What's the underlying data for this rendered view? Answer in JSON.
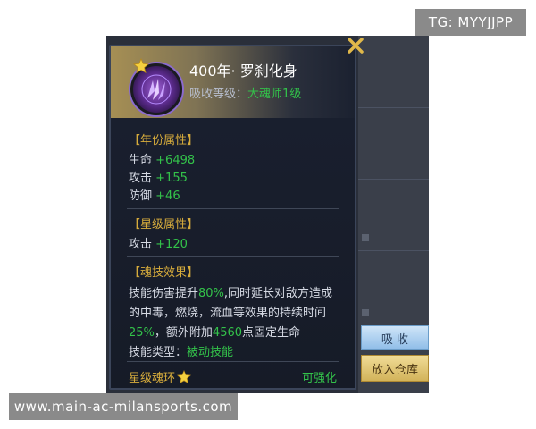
{
  "watermarks": {
    "top": "TG: MYYJJPP",
    "bottom": "www.main-ac-milansports.com"
  },
  "item": {
    "title": "400年·  罗刹化身",
    "absorb_label": "吸收等级：",
    "absorb_value": "大魂师1级",
    "icon": "purple-soul-ring-icon",
    "badge_icon": "gold-star-icon"
  },
  "sections": {
    "year_attrs": {
      "heading": "【年份属性】",
      "stats": [
        {
          "label": "生命",
          "value": "+6498"
        },
        {
          "label": "攻击",
          "value": "+155"
        },
        {
          "label": "防御",
          "value": "+46"
        }
      ]
    },
    "star_attrs": {
      "heading": "【星级属性】",
      "stats": [
        {
          "label": "攻击",
          "value": "+120"
        }
      ]
    },
    "skill_effect": {
      "heading": "【魂技效果】",
      "desc_1": "技能伤害提升",
      "pct_1": "80%",
      "desc_2": ",同时延长对敌方造成的中毒，燃烧，流血等效果的持续时间",
      "pct_2": "25%",
      "desc_3": "，额外附加",
      "flat": "4560",
      "desc_4": "点固定生命",
      "type_label": "技能类型：",
      "type_value": "被动技能"
    }
  },
  "footer": {
    "left_label": "星级魂环",
    "right_label": "可强化"
  },
  "buttons": {
    "absorb": "吸 收",
    "store": "放入仓库"
  },
  "colors": {
    "accent_gold": "#d7ac3c",
    "value_green": "#33c24a",
    "card_bg": "#1a2030",
    "close_gold": "#e0b84a",
    "absorb_button": "#8fbde8",
    "store_button": "#d2b35a"
  }
}
